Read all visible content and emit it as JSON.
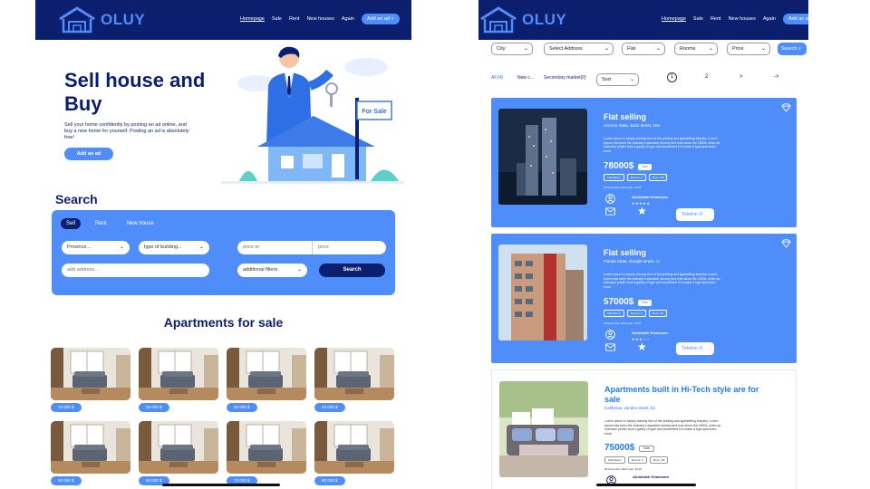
{
  "brand": {
    "name": "OLUY",
    "primary": "#0c1f6f",
    "accent": "#4f8dfb"
  },
  "nav": {
    "items": [
      "Homepage",
      "Sale",
      "Rent",
      "New houses",
      "Again"
    ],
    "add_ad": "Add an ad +"
  },
  "hero": {
    "title": "Sell house and Buy",
    "subtitle": "Sell your home confidently by posting an ad online, and buy a new home for yourself. Posting an ad is absolutely free!",
    "button": "Add an ad",
    "sign": "For Sale"
  },
  "search": {
    "title": "Search",
    "tabs": [
      "Sell",
      "Rent",
      "New house"
    ],
    "province": "Province...",
    "building": "type of building...",
    "price_to": "price to",
    "price": "price",
    "address": "add address...",
    "filters": "additional filters",
    "button": "Search"
  },
  "apartments": {
    "title": "Apartments for sale",
    "prices": [
      "10 000 $",
      "20 000 $",
      "30 000 $",
      "40 000 $",
      "50 000 $",
      "60 000 $",
      "70 000 $",
      "80 000 $"
    ]
  },
  "right_filters": {
    "city": "City",
    "address": "Select Address",
    "flat": "Flat",
    "rooms": "Rooms",
    "price": "Price",
    "search": "Search"
  },
  "right_tabs": {
    "all": "All (4)",
    "new": "New c...",
    "secondary": "Secondary market(0)",
    "sort": "Sort",
    "pages": [
      "1",
      "2",
      ">",
      "->"
    ]
  },
  "listings": [
    {
      "title": "Flat selling",
      "address": "Arizona State, Back street, 10a",
      "desc": "Lorem Ipsum is simply dummy text of the printing and typesetting industry. Lorem Ipsum has been the industry's standard dummy text ever since the 1500s, when an unknown printer took a galley of type and scrambled it to make a type specimen book.",
      "price": "78000$",
      "badge": "Sale",
      "tags": [
        "Flat/ Alkom",
        "Rooms: 4",
        "Floor: 4/5"
      ],
      "date": "28 November 2023 year, 19:15",
      "agent": "Abdullakh Khamzaev",
      "stars": "★★★★★",
      "call": "Telefon"
    },
    {
      "title": "Flat selling",
      "address": "Florida State, Google street, c1",
      "desc": "Lorem Ipsum is simply dummy text of the printing and typesetting industry. Lorem Ipsum has been the industry's standard dummy text ever since the 1500s, when an unknown printer took a galley of type and scrambled it to make a type specimen book.",
      "price": "57000$",
      "badge": "Sale",
      "tags": [
        "Flat/ Alkom",
        "Rooms: 3",
        "Floor: 4/7"
      ],
      "date": "28 November 2023 year, 19:15",
      "agent": "Abdullakh Khamzaev",
      "stars": "★★★☆☆",
      "call": "Telefon"
    },
    {
      "title": "Apartments built in Hi-Tech style are for sale",
      "address": "California, yandex street, b2",
      "desc": "Lorem Ipsum is simply dummy text of the printing and typesetting industry. Lorem Ipsum has been the industry's standard dummy text ever since the 1500s, when an unknown printer took a galley of type and scrambled it to make a type specimen book.",
      "price": "75000$",
      "badge": "Sale",
      "tags": [
        "Flat/ Alkom",
        "Rooms: 4",
        "Floor: 4/8"
      ],
      "date": "28 November 2023 year, 19:15",
      "agent": "Abdullakh Khamzaev"
    }
  ]
}
